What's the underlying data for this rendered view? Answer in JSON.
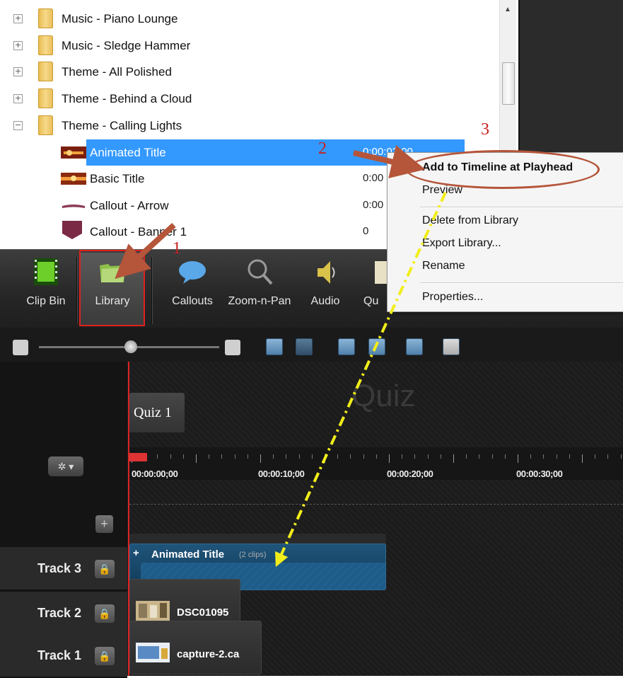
{
  "library": {
    "folders": [
      {
        "label": "Music - Piano Lounge",
        "expander": "+"
      },
      {
        "label": "Music - Sledge Hammer",
        "expander": "+"
      },
      {
        "label": "Theme - All Polished",
        "expander": "+"
      },
      {
        "label": "Theme - Behind a Cloud",
        "expander": "+"
      },
      {
        "label": "Theme - Calling Lights",
        "expander": "−"
      }
    ],
    "items": [
      {
        "label": "Animated Title",
        "duration": "0:00:03;00",
        "selected": true
      },
      {
        "label": "Basic Title",
        "duration": "0:00"
      },
      {
        "label": "Callout - Arrow",
        "duration": "0:00"
      },
      {
        "label": "Callout - Banner 1",
        "duration": "0"
      }
    ]
  },
  "toolbar": {
    "tools": [
      {
        "label": "Clip Bin",
        "icon": "film-icon"
      },
      {
        "label": "Library",
        "icon": "library-folder-icon"
      },
      {
        "label": "Callouts",
        "icon": "speech-bubble-icon"
      },
      {
        "label": "Zoom-n-Pan",
        "icon": "magnifier-icon"
      },
      {
        "label": "Audio",
        "icon": "speaker-icon"
      },
      {
        "label": "Qu",
        "icon": "quiz-icon"
      }
    ]
  },
  "context_menu": {
    "items": [
      {
        "label": "Add to Timeline at Playhead",
        "bold": true
      },
      {
        "label": "Preview"
      },
      {
        "label": "Delete from Library"
      },
      {
        "label": "Export Library..."
      },
      {
        "label": "Rename"
      },
      {
        "label": "Properties..."
      }
    ]
  },
  "timeline": {
    "watermark": "Quiz",
    "quiz_marker": "Quiz 1",
    "time_labels": [
      "00:00:00;00",
      "00:00:10;00",
      "00:00:20;00",
      "00:00:30;00"
    ],
    "tracks": [
      {
        "name": "Track 3",
        "clip": "Animated Title",
        "clip_count": "(2 clips)"
      },
      {
        "name": "Track 2",
        "clip": "DSC01095"
      },
      {
        "name": "Track 1",
        "clip": "capture-2.ca"
      }
    ]
  },
  "annotations": {
    "step1": "1",
    "step2": "2",
    "step3": "3",
    "arrow_color": "#b5553a",
    "dashed_arrow_color": "#f2ee1a",
    "highlight_color": "#e02020"
  }
}
